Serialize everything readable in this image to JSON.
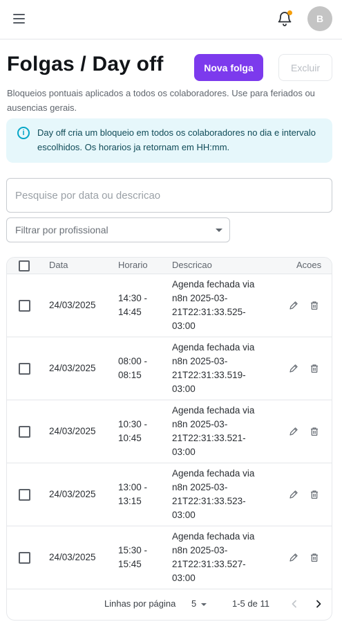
{
  "header": {
    "avatar_initial": "B",
    "notification_dot_color": "#f59e0b"
  },
  "page": {
    "title": "Folgas / Day off",
    "new_button": "Nova folga",
    "delete_button": "Excluir",
    "subtitle": "Bloqueios pontuais aplicados a todos os colaboradores. Use para feriados ou ausencias gerais.",
    "info": "Day off cria um bloqueio em todos os colaboradores no dia e intervalo escolhidos. Os horarios ja retornam em HH:mm.",
    "accent_color": "#7c3aed"
  },
  "search": {
    "placeholder": "Pesquise por data ou descricao",
    "value": ""
  },
  "filter": {
    "label": "Filtrar por profissional"
  },
  "table": {
    "columns": {
      "data": "Data",
      "horario": "Horario",
      "descricao": "Descricao",
      "acoes": "Acoes"
    },
    "rows": [
      {
        "date": "24/03/2025",
        "time_start": "14:30 -",
        "time_end": "14:45",
        "desc": [
          "Agenda fechada via",
          "n8n 2025-03-",
          "21T22:31:33.525-",
          "03:00"
        ]
      },
      {
        "date": "24/03/2025",
        "time_start": "08:00 -",
        "time_end": "08:15",
        "desc": [
          "Agenda fechada via",
          "n8n 2025-03-",
          "21T22:31:33.519-",
          "03:00"
        ]
      },
      {
        "date": "24/03/2025",
        "time_start": "10:30 -",
        "time_end": "10:45",
        "desc": [
          "Agenda fechada via",
          "n8n 2025-03-",
          "21T22:31:33.521-",
          "03:00"
        ]
      },
      {
        "date": "24/03/2025",
        "time_start": "13:00 -",
        "time_end": "13:15",
        "desc": [
          "Agenda fechada via",
          "n8n 2025-03-",
          "21T22:31:33.523-",
          "03:00"
        ]
      },
      {
        "date": "24/03/2025",
        "time_start": "15:30 -",
        "time_end": "15:45",
        "desc": [
          "Agenda fechada via",
          "n8n 2025-03-",
          "21T22:31:33.527-",
          "03:00"
        ]
      }
    ]
  },
  "pagination": {
    "rows_label": "Linhas por página",
    "rows_value": "5",
    "range": "1-5 de 11"
  }
}
